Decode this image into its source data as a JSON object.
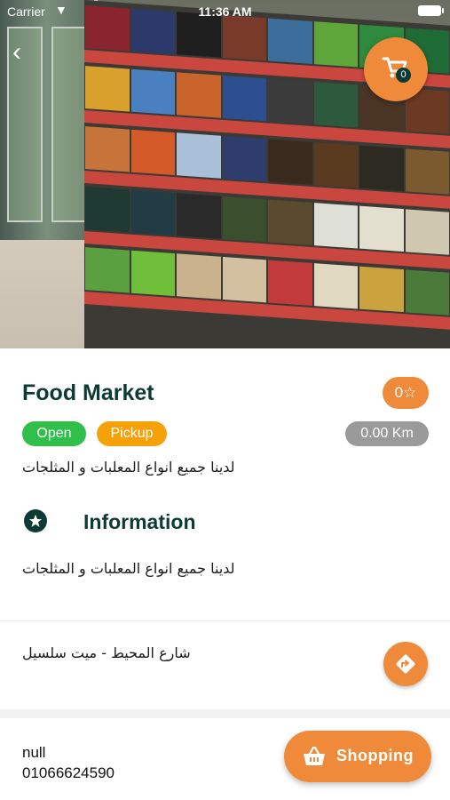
{
  "status_bar": {
    "carrier": "Carrier",
    "time": "11:36 AM"
  },
  "cart": {
    "count": "0"
  },
  "store": {
    "name": "Food Market",
    "rating": "0☆",
    "status_tag": "Open",
    "service_tag": "Pickup",
    "distance": "0.00 Km",
    "description": "لدينا جميع انواع المعلبات و المثلجات"
  },
  "information": {
    "heading": "Information",
    "text": "لدينا جميع انواع المعلبات و المثلجات"
  },
  "address": {
    "text": "شارع المحيط - ميت سلسيل"
  },
  "contact": {
    "name": "null",
    "phone": "01066624590"
  },
  "actions": {
    "shopping_label": "Shopping"
  },
  "colors": {
    "accent": "#f08a3b",
    "primary_dark": "#0d3b34",
    "open_green": "#2fbf4a",
    "pickup_orange": "#f5a20a",
    "distance_grey": "#9a9a9a"
  }
}
